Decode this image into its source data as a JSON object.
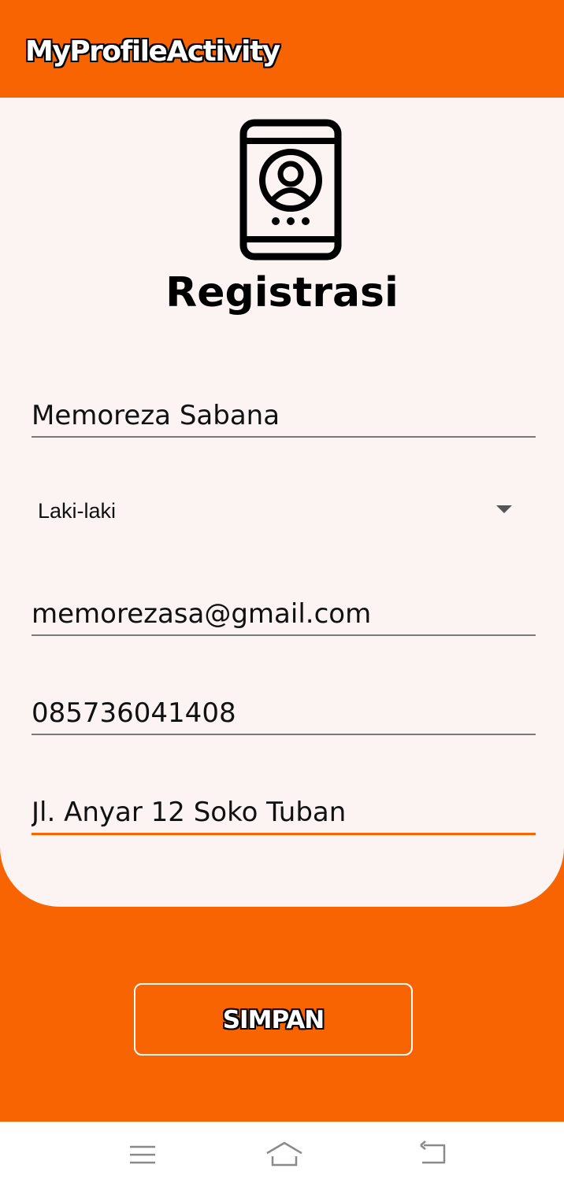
{
  "appbar": {
    "title": "MyProfileActivity"
  },
  "form": {
    "heading": "Registrasi",
    "name_value": "Memoreza Sabana",
    "gender_value": "Laki-laki",
    "email_value": "memorezasa@gmail.com",
    "phone_value": "085736041408",
    "address_value": "Jl. Anyar 12 Soko Tuban"
  },
  "actions": {
    "save_label": "SIMPAN"
  },
  "colors": {
    "accent": "#f86402",
    "card": "#fcf4f2"
  },
  "icons": {
    "logo": "phone-profile-icon",
    "nav_menu": "menu-icon",
    "nav_home": "home-icon",
    "nav_back": "back-icon"
  }
}
